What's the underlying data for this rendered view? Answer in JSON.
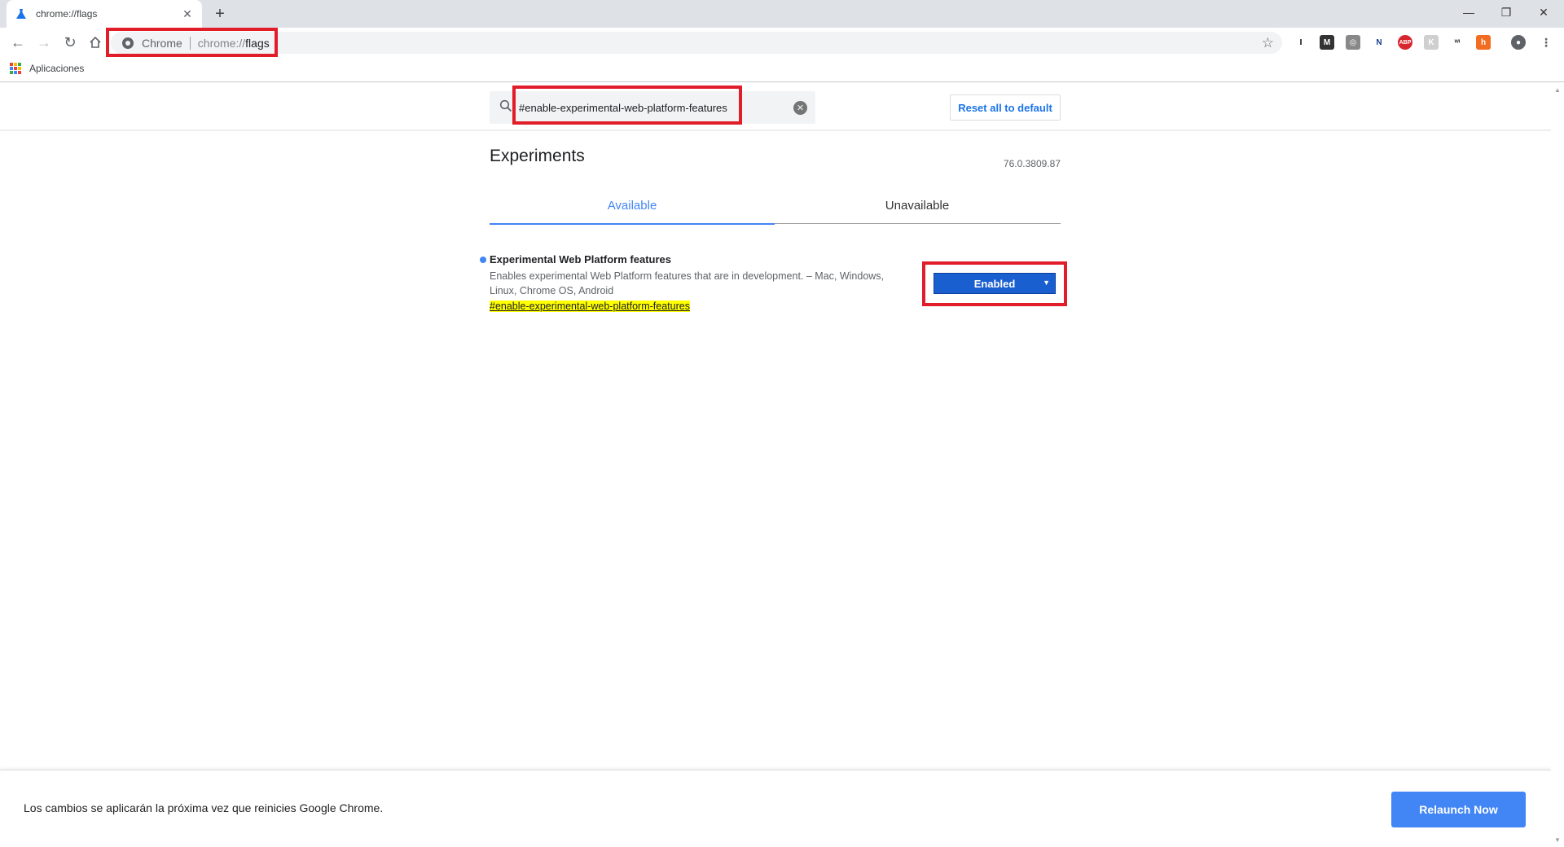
{
  "browser": {
    "tab_title": "chrome://flags",
    "omnibox": {
      "chip": "Chrome",
      "scheme": "chrome://",
      "host": "flags"
    },
    "bookmarks": {
      "apps_label": "Aplicaciones"
    },
    "extensions": [
      {
        "name": "instapaper-icon",
        "glyph": "I",
        "color": "#ffffff",
        "text": "#000000"
      },
      {
        "name": "mega-icon",
        "glyph": "M",
        "color": "#333333",
        "text": "#ffffff"
      },
      {
        "name": "world-icon",
        "glyph": "◎",
        "color": "#888888",
        "text": "#ffffff"
      },
      {
        "name": "news-icon",
        "glyph": "N",
        "color": "#ffffff",
        "text": "#1a3d8f"
      },
      {
        "name": "adblock-icon",
        "glyph": "ABP",
        "color": "#d8262e",
        "text": "#ffffff"
      },
      {
        "name": "k-icon",
        "glyph": "K",
        "color": "#cfcfcf",
        "text": "#ffffff"
      },
      {
        "name": "wifi-icon",
        "glyph": "ʷᶦ",
        "color": "#ffffff",
        "text": "#333333"
      },
      {
        "name": "honey-icon",
        "glyph": "h",
        "color": "#f26c21",
        "text": "#ffffff"
      }
    ]
  },
  "header": {
    "search_value": "#enable-experimental-web-platform-features",
    "reset_label": "Reset all to default"
  },
  "main": {
    "title": "Experiments",
    "version": "76.0.3809.87",
    "tabs": [
      {
        "label": "Available",
        "active": true
      },
      {
        "label": "Unavailable",
        "active": false
      }
    ],
    "experiment": {
      "name": "Experimental Web Platform features",
      "description": "Enables experimental Web Platform features that are in development. – Mac, Windows, Linux, Chrome OS, Android",
      "link": "#enable-experimental-web-platform-features",
      "selected": "Enabled"
    }
  },
  "footer": {
    "message": "Los cambios se aplicarán la próxima vez que reinicies Google Chrome.",
    "relaunch_label": "Relaunch Now"
  },
  "colors": {
    "accent": "#4285f4",
    "highlight_box": "#e11d2a",
    "enabled_select": "#1a5fd0"
  }
}
